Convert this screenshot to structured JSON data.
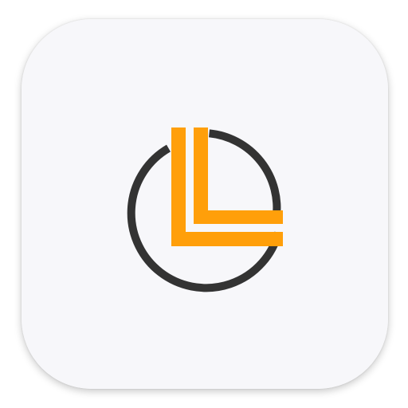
{
  "icon": {
    "name": "ll-circle-logo",
    "colors": {
      "background": "#f7f7fa",
      "ring": "#333333",
      "accent": "#ff9f0a"
    }
  }
}
